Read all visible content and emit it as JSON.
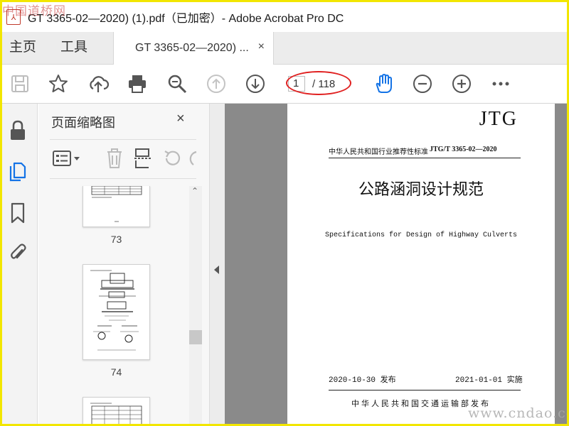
{
  "window": {
    "title": "GT 3365-02—2020) (1).pdf（已加密）- Adobe Acrobat Pro DC",
    "watermark_top": "中国道桥网"
  },
  "tabs": {
    "home": "主页",
    "tools": "工具",
    "document": "GT 3365-02—2020) ...",
    "close": "×"
  },
  "toolbar": {
    "icons": [
      "save-icon",
      "bookmark-star-icon",
      "upload-cloud-icon",
      "print-icon",
      "zoom-search-icon",
      "page-up-icon",
      "page-down-icon",
      "hand-tool-icon",
      "zoom-out-icon",
      "zoom-in-icon",
      "more-icon"
    ],
    "page_current": "1",
    "page_total": "/ 118",
    "accent_color": "#1473e6"
  },
  "rail": {
    "icons": [
      "lock-icon",
      "pages-icon",
      "bookmark-icon",
      "attachment-icon"
    ]
  },
  "thumbnails_panel": {
    "title": "页面缩略图",
    "close": "×",
    "pages": [
      {
        "label": "73"
      },
      {
        "label": "74"
      },
      {
        "label": ""
      }
    ]
  },
  "document": {
    "logo_text": "JTG",
    "standard_category": "中华人民共和国行业推荐性标准",
    "standard_code": "JTG/T 3365-02—2020",
    "title_cn": "公路涵洞设计规范",
    "title_en": "Specifications for Design of Highway Culverts",
    "issue_date": "2020-10-30 发布",
    "effective_date": "2021-01-01 实施",
    "publisher": "中华人民共和国交通运输部发布"
  },
  "watermark_bottom": "www.cndao.com"
}
